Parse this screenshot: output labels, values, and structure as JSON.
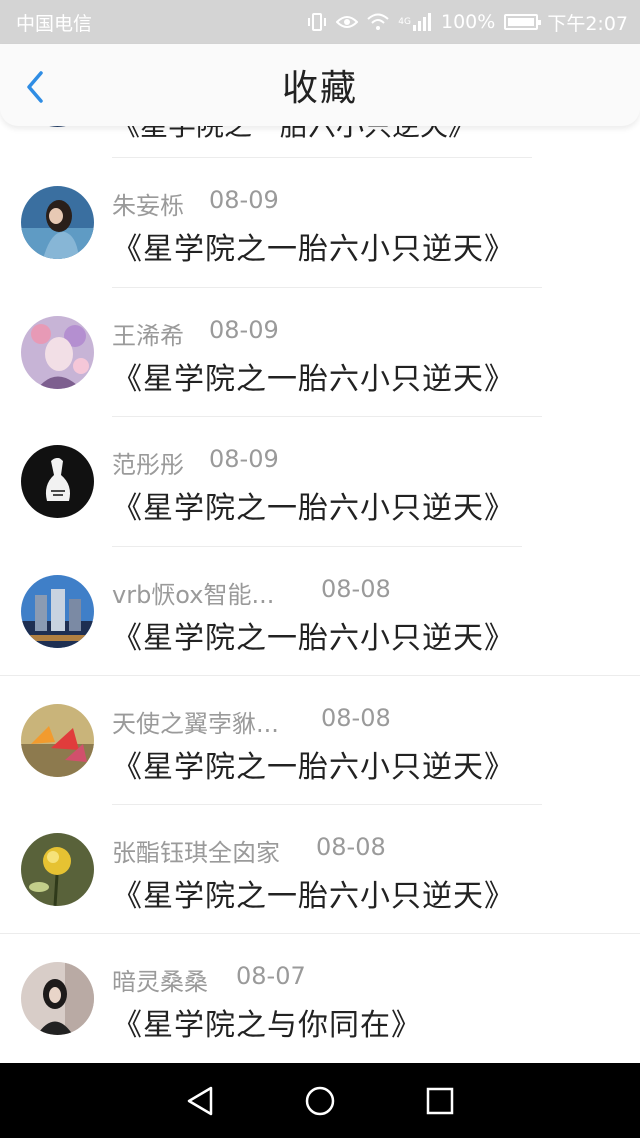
{
  "status_bar": {
    "carrier": "中国电信",
    "battery": "100%",
    "time": "下午2:07",
    "network": "4G"
  },
  "header": {
    "title": "收藏"
  },
  "partial_row": {
    "book": "《星学院之一胎六小只逆天》"
  },
  "items": [
    {
      "name": "朱妄栎",
      "date": "08-09",
      "book": "《星学院之一胎六小只逆天》"
    },
    {
      "name": "王浠希",
      "date": "08-09",
      "book": "《星学院之一胎六小只逆天》"
    },
    {
      "name": "范彤彤",
      "date": "08-09",
      "book": "《星学院之一胎六小只逆天》"
    },
    {
      "name": "vrb恹ox智能...",
      "date": "08-08",
      "book": "《星学院之一胎六小只逆天》"
    },
    {
      "name": "天使之翼孛貅...",
      "date": "08-08",
      "book": "《星学院之一胎六小只逆天》"
    },
    {
      "name": "张酯钰琪全囟家",
      "date": "08-08",
      "book": "《星学院之一胎六小只逆天》"
    },
    {
      "name": "暗灵桑桑",
      "date": "08-07",
      "book": "《星学院之与你同在》"
    }
  ],
  "colors": {
    "accent": "#2f8de4",
    "meta_text": "#9a9a9a",
    "primary_text": "#222222"
  }
}
